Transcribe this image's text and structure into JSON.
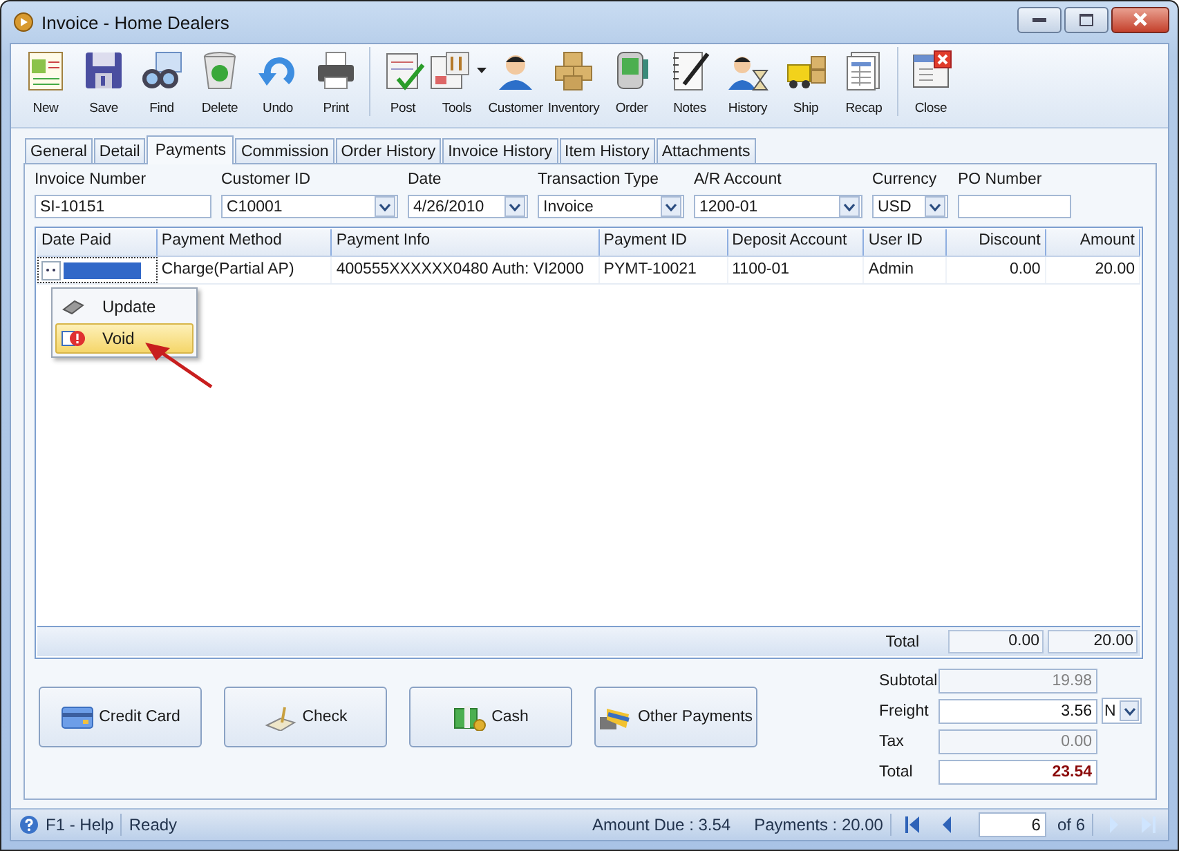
{
  "window": {
    "title": "Invoice - Home Dealers"
  },
  "toolbar": [
    {
      "label": "New",
      "separator_before": false,
      "dropdown": false
    },
    {
      "label": "Save",
      "separator_before": false,
      "dropdown": false
    },
    {
      "label": "Find",
      "separator_before": false,
      "dropdown": false
    },
    {
      "label": "Delete",
      "separator_before": false,
      "dropdown": false
    },
    {
      "label": "Undo",
      "separator_before": false,
      "dropdown": false
    },
    {
      "label": "Print",
      "separator_before": false,
      "dropdown": false
    },
    {
      "label": "Post",
      "separator_before": true,
      "dropdown": false
    },
    {
      "label": "Tools",
      "separator_before": false,
      "dropdown": true
    },
    {
      "label": "Customer",
      "separator_before": false,
      "dropdown": false
    },
    {
      "label": "Inventory",
      "separator_before": false,
      "dropdown": false
    },
    {
      "label": "Order",
      "separator_before": false,
      "dropdown": false
    },
    {
      "label": "Notes",
      "separator_before": false,
      "dropdown": false
    },
    {
      "label": "History",
      "separator_before": false,
      "dropdown": false
    },
    {
      "label": "Ship",
      "separator_before": false,
      "dropdown": false
    },
    {
      "label": "Recap",
      "separator_before": false,
      "dropdown": false
    },
    {
      "label": "Close",
      "separator_before": true,
      "dropdown": false
    }
  ],
  "tabs": [
    {
      "label": "General",
      "selected": false
    },
    {
      "label": "Detail",
      "selected": false
    },
    {
      "label": "Payments",
      "selected": true
    },
    {
      "label": "Commission",
      "selected": false
    },
    {
      "label": "Order History",
      "selected": false
    },
    {
      "label": "Invoice History",
      "selected": false
    },
    {
      "label": "Item History",
      "selected": false
    },
    {
      "label": "Attachments",
      "selected": false
    }
  ],
  "fields": [
    {
      "label": "Invoice Number",
      "value": "SI-10151",
      "dropdown": false
    },
    {
      "label": "Customer ID",
      "value": "C10001",
      "dropdown": true
    },
    {
      "label": "Date",
      "value": "4/26/2010",
      "dropdown": true
    },
    {
      "label": "Transaction Type",
      "value": "Invoice",
      "dropdown": true
    },
    {
      "label": "A/R Account",
      "value": "1200-01",
      "dropdown": true
    },
    {
      "label": "Currency",
      "value": "USD",
      "dropdown": true
    },
    {
      "label": "PO Number",
      "dropdown": false
    }
  ],
  "table": {
    "columns": [
      {
        "label": "Date Paid",
        "kind": "text"
      },
      {
        "label": "Payment Method",
        "kind": "text"
      },
      {
        "label": "Payment Info",
        "kind": "text"
      },
      {
        "label": "Payment ID",
        "kind": "text"
      },
      {
        "label": "Deposit Account",
        "kind": "text"
      },
      {
        "label": "User ID",
        "kind": "text"
      },
      {
        "label": "Discount",
        "kind": "number"
      },
      {
        "label": "Amount",
        "kind": "number"
      }
    ],
    "rows": [
      {
        "selected": true,
        "cells": [
          "",
          "Charge(Partial AP)",
          "400555XXXXXX0480 Auth: VI2000",
          "PYMT-10021",
          "1100-01",
          "Admin",
          "0.00",
          "20.00"
        ]
      }
    ],
    "footer": {
      "label": "Total",
      "discount": "0.00",
      "amount": "20.00"
    }
  },
  "context_menu": [
    {
      "label": "Update",
      "selected": false
    },
    {
      "label": "Void",
      "selected": true
    }
  ],
  "payment_buttons": [
    "Credit Card",
    "Check",
    "Cash",
    "Other Payments"
  ],
  "summary": [
    {
      "label": "Subtotal",
      "value": "19.98",
      "kind": "readonly"
    },
    {
      "label": "Freight",
      "value": "3.56",
      "kind": "editable",
      "option": "N"
    },
    {
      "label": "Tax",
      "value": "0.00",
      "kind": "readonly"
    },
    {
      "label": "Total",
      "value": "23.54",
      "kind": "total"
    }
  ],
  "status_bar": {
    "help": "F1 - Help",
    "status": "Ready",
    "amount_due": "Amount Due : 3.54",
    "payments": "Payments : 20.00",
    "record": "6",
    "of": "of 6",
    "nav": [
      {
        "kind": "first",
        "disabled": false
      },
      {
        "kind": "prev",
        "disabled": false
      },
      {
        "kind": "next",
        "disabled": true
      },
      {
        "kind": "last",
        "disabled": true
      }
    ]
  }
}
